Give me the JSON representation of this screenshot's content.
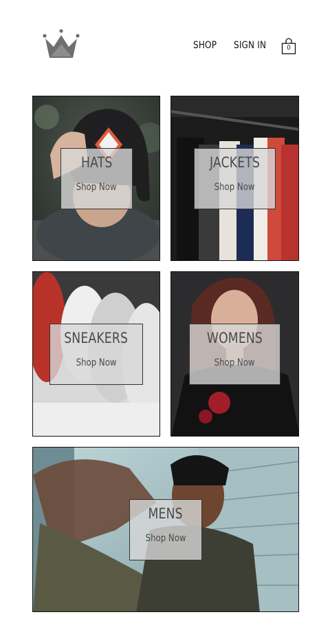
{
  "header": {
    "logo_icon": "crown-icon",
    "nav": {
      "shop_label": "SHOP",
      "signin_label": "SIGN IN"
    },
    "cart": {
      "icon": "shopping-bag-icon",
      "count": "0"
    }
  },
  "categories": [
    {
      "title": "HATS",
      "link": "Shop Now"
    },
    {
      "title": "JACKETS",
      "link": "Shop Now"
    },
    {
      "title": "SNEAKERS",
      "link": "Shop Now"
    },
    {
      "title": "WOMENS",
      "link": "Shop Now"
    },
    {
      "title": "MENS",
      "link": "Shop Now"
    }
  ],
  "colors": {
    "text": "#111111",
    "overlay": "#d7d7d7",
    "border": "#111111"
  }
}
